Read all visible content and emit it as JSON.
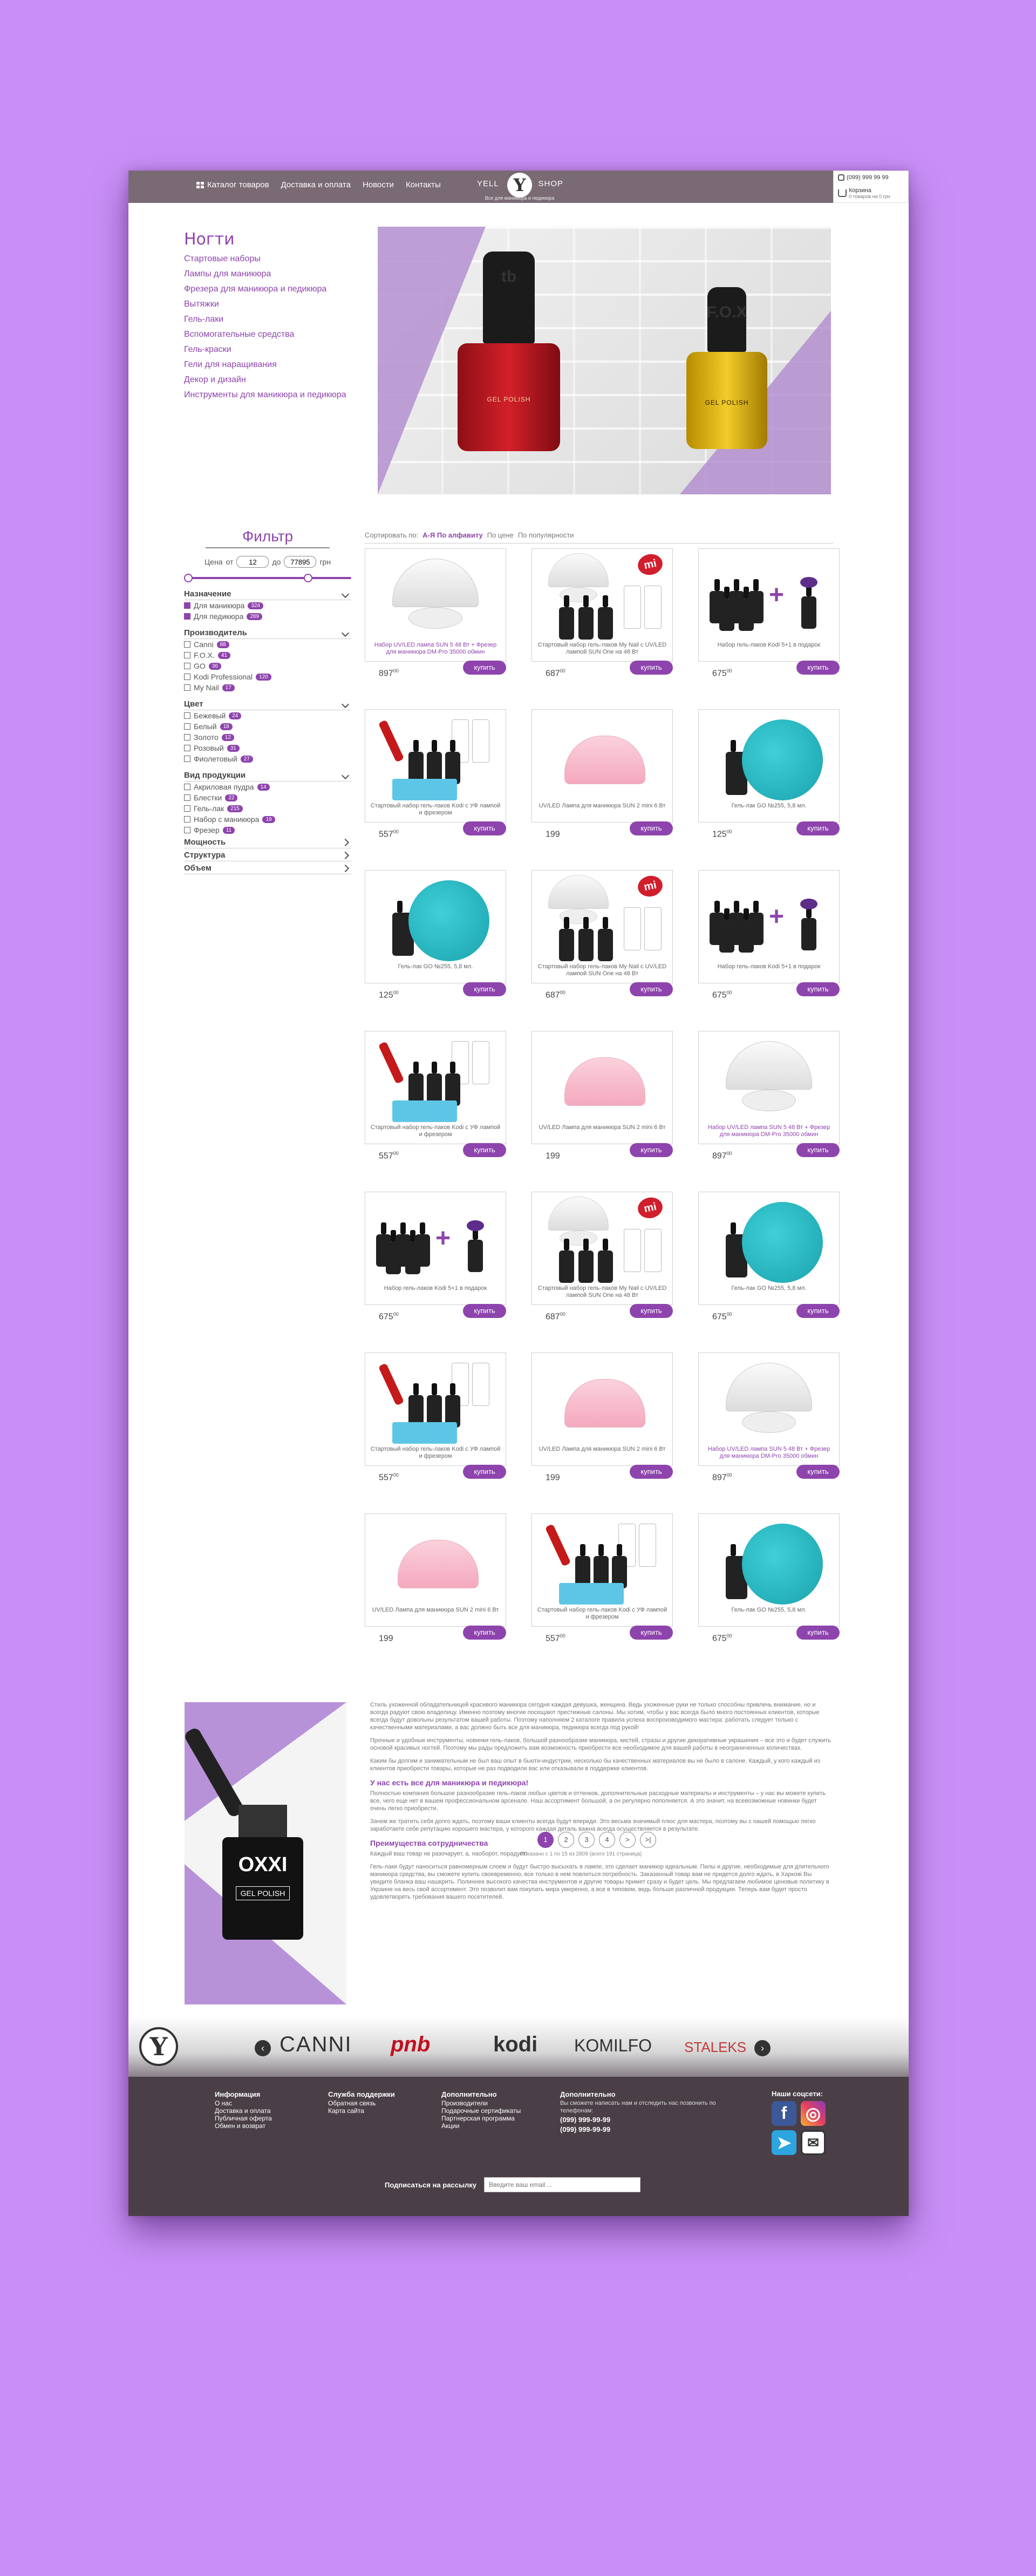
{
  "header": {
    "nav": [
      "Каталог товаров",
      "Доставка и оплата",
      "Новости",
      "Контакты"
    ],
    "logo_left": "YELL",
    "logo_mid": "Y",
    "logo_right": "SHOP",
    "logo_sub": "Все для маникюра и педикюра",
    "phone": "(099) 999 99 99",
    "cart_label": "Корзина",
    "cart_sub": "0 товаров на 0 грн"
  },
  "category": {
    "title": "Ногти",
    "items": [
      "Стартовые наборы",
      "Лампы для маникюра",
      "Фрезера для маникюра и педикюра",
      "Вытяжки",
      "Гель-лаки",
      "Вспомогательные средства",
      "Гель-краски",
      "Гели для наращивания",
      "Декор и дизайн",
      "Инструменты для маникюра и педикюра"
    ]
  },
  "banner": {
    "brand1": "tb",
    "brand1_sub": "GEL POLISH",
    "brand2": "F.O.X",
    "brand2_sub": "GEL POLISH"
  },
  "filter": {
    "title": "Фильтр",
    "price_label": "Цена",
    "from_label": "от",
    "to_label": "до",
    "currency": "грн",
    "min": "12",
    "max": "77895",
    "sections": [
      {
        "title": "Назначение",
        "items": [
          {
            "label": "Для маникюра",
            "count": "324",
            "checked": true
          },
          {
            "label": "Для педикюра",
            "count": "289",
            "checked": true
          }
        ]
      },
      {
        "title": "Производитель",
        "items": [
          {
            "label": "Canni",
            "count": "88"
          },
          {
            "label": "F.O.X.",
            "count": "41"
          },
          {
            "label": "GO",
            "count": "36"
          },
          {
            "label": "Kodi Professional",
            "count": "120"
          },
          {
            "label": "My Nail",
            "count": "17"
          }
        ]
      },
      {
        "title": "Цвет",
        "items": [
          {
            "label": "Бежевый",
            "count": "24"
          },
          {
            "label": "Белый",
            "count": "18"
          },
          {
            "label": "Золото",
            "count": "12"
          },
          {
            "label": "Розовый",
            "count": "31"
          },
          {
            "label": "Фиолетовый",
            "count": "27"
          }
        ]
      },
      {
        "title": "Вид продукции",
        "items": [
          {
            "label": "Акриловая пудра",
            "count": "14"
          },
          {
            "label": "Блестки",
            "count": "22"
          },
          {
            "label": "Гель-лак",
            "count": "215"
          },
          {
            "label": "Набор с маникюра",
            "count": "19"
          },
          {
            "label": "Фрезер",
            "count": "11"
          }
        ]
      }
    ],
    "collapsed": [
      "Мощность",
      "Структура",
      "Объем"
    ]
  },
  "sort": {
    "label": "Сортировать по:",
    "options": [
      "А-Я По алфавиту",
      "По цене",
      "По популярности"
    ]
  },
  "buy_label": "купить",
  "products": [
    {
      "pic": "lamp",
      "name": "Набор UV/LED лампа SUN 5 48 Вт + Фрезер для маникюра DM-Pro 35000 обмин",
      "v": true,
      "price": "897",
      "cents": "00"
    },
    {
      "pic": "set",
      "name": "Стартовый набор гель-лаков My Nail с UV/LED лампой SUN One на 48 Вт",
      "v": false,
      "price": "687",
      "cents": "00"
    },
    {
      "pic": "kit5",
      "name": "Набор гель-лаков Kodi 5+1 в подарок",
      "v": false,
      "price": "675",
      "cents": "00"
    },
    {
      "pic": "starter",
      "name": "Стартовый набор гель-лаков Kodi с УФ лампой и фрезером",
      "v": false,
      "price": "557",
      "cents": "00"
    },
    {
      "pic": "mini",
      "name": "UV/LED Лампа для маникюра SUN 2 mini 6 Вт",
      "v": false,
      "price": "199",
      "cents": ""
    },
    {
      "pic": "swatch",
      "name": "Гель-лак GO №255, 5,8 мл.",
      "v": false,
      "price": "125",
      "cents": "00"
    },
    {
      "pic": "swatch",
      "name": "Гель-лак GO №255, 5,8 мл.",
      "v": false,
      "price": "125",
      "cents": "00"
    },
    {
      "pic": "set",
      "name": "Стартовый набор гель-лаков My Nail с UV/LED лампой SUN One на 48 Вт",
      "v": false,
      "price": "687",
      "cents": "00"
    },
    {
      "pic": "kit5",
      "name": "Набор гель-лаков Kodi 5+1 в подарок",
      "v": false,
      "price": "675",
      "cents": "00"
    },
    {
      "pic": "starter",
      "name": "Стартовый набор гель-лаков Kodi с УФ лампой и фрезером",
      "v": false,
      "price": "557",
      "cents": "00"
    },
    {
      "pic": "mini",
      "name": "UV/LED Лампа для маникюра SUN 2 mini 6 Вт",
      "v": false,
      "price": "199",
      "cents": ""
    },
    {
      "pic": "lamp",
      "name": "Набор UV/LED лампа SUN 5 48 Вт + Фрезер для маникюра DM-Pro 35000 обмин",
      "v": true,
      "price": "897",
      "cents": "00"
    },
    {
      "pic": "kit5",
      "name": "Набор гель-лаков Kodi 5+1 в подарок",
      "v": false,
      "price": "675",
      "cents": "00"
    },
    {
      "pic": "set",
      "name": "Стартовый набор гель-лаков My Nail с UV/LED лампой SUN One на 48 Вт",
      "v": false,
      "price": "687",
      "cents": "00"
    },
    {
      "pic": "swatch",
      "name": "Гель-лак GO №255, 5,8 мл.",
      "v": false,
      "price": "675",
      "cents": "00"
    },
    {
      "pic": "starter",
      "name": "Стартовый набор гель-лаков Kodi с УФ лампой и фрезером",
      "v": false,
      "price": "557",
      "cents": "00"
    },
    {
      "pic": "mini",
      "name": "UV/LED Лампа для маникюра SUN 2 mini 6 Вт",
      "v": false,
      "price": "199",
      "cents": ""
    },
    {
      "pic": "lamp",
      "name": "Набор UV/LED лампа SUN 5 48 Вт + Фрезер для маникюра DM-Pro 35000 обмин",
      "v": true,
      "price": "897",
      "cents": "00"
    },
    {
      "pic": "mini",
      "name": "UV/LED Лампа для маникюра SUN 2 mini 6 Вт",
      "v": false,
      "price": "199",
      "cents": ""
    },
    {
      "pic": "starter",
      "name": "Стартовый набор гель-лаков Kodi с УФ лампой и фрезером",
      "v": false,
      "price": "557",
      "cents": "00"
    },
    {
      "pic": "swatch",
      "name": "Гель-лак GO №255, 5,8 мл.",
      "v": false,
      "price": "675",
      "cents": "00"
    }
  ],
  "pager": {
    "pages": [
      "1",
      "2",
      "3",
      "4"
    ],
    "next": ">",
    "last": ">|",
    "note": "Показано с 1 по 15 из 2809 (всего 191 страница)"
  },
  "seo": {
    "p1": "Стиль ухоженной обладательницей красивого маникюра сегодня каждая девушка, женщина. Ведь ухоженные руки не только способны привлечь внимание, но и всегда радуют свою владелицу. Именно поэтому многие посещают престижные салоны. Мы хотим, чтобы у вас всегда было много постоянных клиентов, которые всегда будут довольны результатом вашей работы. Поэтому наполняем 2 каталоге правила успеха воспроизводимого мастера: работать следует только с качественными материалами, а вас должно быть все для маникюра, педикюра всегда под рукой!",
    "p2": "Прочные и удобные инструменты, новинки гель-лаков, большой разнообразие маникюра, кистей, стразы и другие декоративные украшения – все это и будет служить основой красивых ногтей. Поэтому мы рады предложить вам возможность приобрести все необходимое для вашей работы в неограниченных количествах.",
    "p3": "Каким бы долгим и занимательным не был ваш опыт в бьюти-индустрии, несколько бы качественных материалов вы не было в салоне. Каждый, у кого каждый из клиентов приобрести товары, которые не раз подводили вас или отказывали в поддержке клиентов.",
    "h1": "У нас есть все для маникюра и педикюра!",
    "p4": "Полностью компания большое разнообразие гель-лаков любых цветов и оттенков, дополнительные расходные материалы и инструменты – у нас вы можете купить все, чего еще нет в вашем профессиональном арсенале. Наш ассортимент большой, а он регулярно пополняется. А это значит, на всевозможные новинки будет очень легко приобрести.",
    "p5": "Зачем же тратить себя долго ждать, поэтому ваши клиенты всегда будут впереди. Это весьма значимый плюс для мастера, поэтому вы с нашей помощью легко заработаете себе репутацию хорошего мастера, у которого каждая деталь важна всегда осуществляется в результате.",
    "h2": "Преимущества сотрудничества",
    "p6": "Каждый ваш товар не разочарует, а, наоборот, порадует!",
    "p7": "Гель-лаки будут наноситься равномерным слоем и будут быстро высыхать в лампе, это сделает маникюр идеальным. Пилы и другие, необходимые для длительного маникюра средства, вы сможете купить своевременно, все только в нем повлиться потребность. Заказанный товар вам не придется долго ждать, в Харкові Вы увидите бланка ваш нашкрить. Полиннее высокого качества инструментов и другие товары примет сразу и будет цель. Мы предлагаем любимое ценовые политику в Украине на весь свой ассортимент. Это позволит вам покупать мира умеренно, а все в типовом, ведь больше различной продукции. Теперь вам будет просто удовлетворять требования вашего посетителей."
  },
  "seo_img": {
    "brand": "OXXI",
    "sub": "GEL POLISH"
  },
  "footer": {
    "logo": "Y",
    "prev": "‹",
    "next": "›",
    "brands": [
      "CANNI",
      "pnb",
      "kodi",
      "KOMILFO",
      "STALEKS"
    ],
    "col1": {
      "title": "Информация",
      "items": [
        "О нас",
        "Доставка и оплата",
        "Публичная оферта",
        "Обмен и возврат"
      ]
    },
    "col2": {
      "title": "Служба поддержки",
      "items": [
        "Обратная связь",
        "Карта сайта"
      ]
    },
    "col3": {
      "title": "Дополнительно",
      "items": [
        "Производители",
        "Подарочные сертификаты",
        "Партнерская программа",
        "Акции"
      ]
    },
    "col4": {
      "title": "Дополнительно",
      "info": "Вы сможете написать нам и отследить нас позвонить по телефонам:",
      "phone1": "(099) 999-99-99",
      "phone2": "(099) 999-99-99"
    },
    "social_title": "Наши соцсети:",
    "subscribe_label": "Подписаться на рассылку",
    "subscribe_placeholder": "Введите ваш email ..."
  },
  "colors": {
    "accent": "#8e44ad",
    "header": "#7a6a74",
    "background": "#c98ff7",
    "footer": "#4a3f47"
  }
}
